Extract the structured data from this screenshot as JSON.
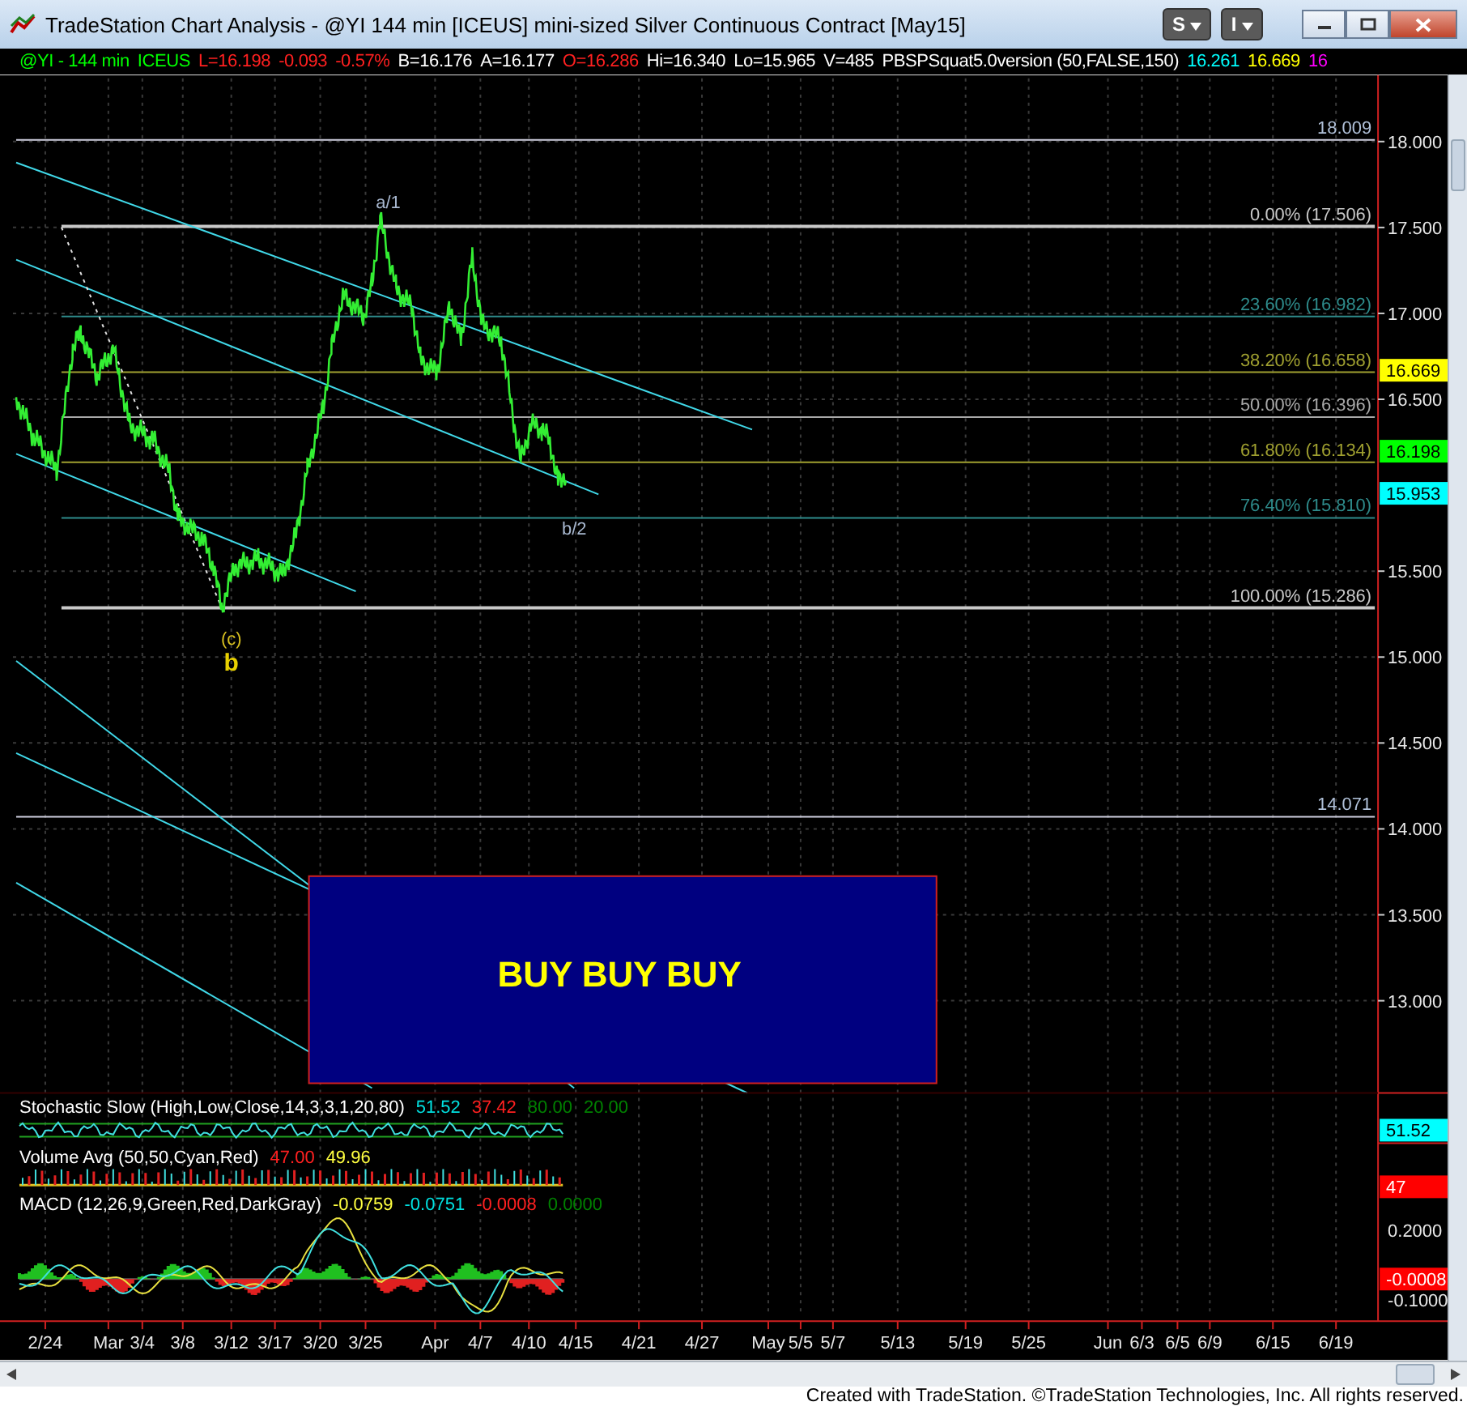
{
  "window": {
    "title": "TradeStation Chart Analysis - @YI 144 min [ICEUS] mini-sized Silver Continuous Contract [May15]"
  },
  "toolbar_buttons": [
    {
      "label": "S"
    },
    {
      "label": "I"
    }
  ],
  "status_line": [
    {
      "text": "@YI - 144 min",
      "color": "#00ff00"
    },
    {
      "text": "ICEUS",
      "color": "#00ff00"
    },
    {
      "text": "L=16.198",
      "color": "#ff2020"
    },
    {
      "text": "-0.093",
      "color": "#ff2020"
    },
    {
      "text": "-0.57%",
      "color": "#ff2020"
    },
    {
      "text": "B=16.176",
      "color": "#ffffff"
    },
    {
      "text": "A=16.177",
      "color": "#ffffff"
    },
    {
      "text": "O=16.286",
      "color": "#ff2020"
    },
    {
      "text": "Hi=16.340",
      "color": "#ffffff"
    },
    {
      "text": "Lo=15.965",
      "color": "#ffffff"
    },
    {
      "text": "V=485",
      "color": "#ffffff"
    },
    {
      "text": "PBSPSquat5.0version (50,FALSE,150)",
      "color": "#ffffff"
    },
    {
      "text": "16.261",
      "color": "#00ffff"
    },
    {
      "text": "16.669",
      "color": "#ffff00"
    },
    {
      "text": "16",
      "color": "#ff00ff"
    }
  ],
  "price_axis": {
    "labels": [
      "18.000",
      "17.500",
      "17.000",
      "16.500",
      "15.500",
      "15.000",
      "14.500",
      "14.000",
      "13.500",
      "13.000"
    ],
    "markers": [
      {
        "text": "16.669",
        "color": "#ffff00"
      },
      {
        "text": "16.198",
        "color": "#00ff00"
      },
      {
        "text": "15.953",
        "color": "#00ffff"
      }
    ]
  },
  "levels": [
    {
      "label": "18.009"
    },
    {
      "label": "14.071"
    }
  ],
  "fib_lines": [
    {
      "label": "0.00% (17.506)",
      "color": "#c8c8c8"
    },
    {
      "label": "23.60% (16.982)",
      "color": "#2e8b8b"
    },
    {
      "label": "38.20% (16.658)",
      "color": "#a0a030"
    },
    {
      "label": "50.00% (16.396)",
      "color": "#a8a8a8"
    },
    {
      "label": "61.80% (16.134)",
      "color": "#a0a030"
    },
    {
      "label": "76.40% (15.810)",
      "color": "#2e8b8b"
    },
    {
      "label": "100.00% (15.286)",
      "color": "#c8c8c8"
    }
  ],
  "annotations": [
    {
      "text": "a/1"
    },
    {
      "text": "b/2"
    },
    {
      "text": "(c)"
    },
    {
      "text": "b"
    }
  ],
  "buy_box": {
    "text": "BUY BUY BUY"
  },
  "indicators": [
    {
      "label": "Stochastic Slow (High,Low,Close,14,3,3,1,20,80)",
      "values": [
        {
          "text": "51.52",
          "color": "#00e0e0"
        },
        {
          "text": "37.42",
          "color": "#ff2020"
        },
        {
          "text": "80.00",
          "color": "#008000"
        },
        {
          "text": "20.00",
          "color": "#008000"
        }
      ],
      "axis_marker": {
        "text": "51.52",
        "color": "#00ffff"
      }
    },
    {
      "label": "Volume Avg (50,50,Cyan,Red)",
      "values": [
        {
          "text": "47.00",
          "color": "#ff2020"
        },
        {
          "text": "49.96",
          "color": "#ffff40"
        }
      ],
      "axis_marker": {
        "text": "47",
        "color": "#ff0000"
      }
    },
    {
      "label": "MACD (12,26,9,Green,Red,DarkGray)",
      "values": [
        {
          "text": "-0.0759",
          "color": "#ffff40"
        },
        {
          "text": "-0.0751",
          "color": "#00e0e0"
        },
        {
          "text": "-0.0008",
          "color": "#ff2020"
        },
        {
          "text": "0.0000",
          "color": "#008000"
        }
      ],
      "axis_marker": {
        "text": "-0.0008",
        "color": "#ff0000"
      }
    }
  ],
  "macd_axis": [
    "0.2000",
    "-0.1000"
  ],
  "date_axis": [
    "2/24",
    "Mar",
    "3/4",
    "3/8",
    "3/12",
    "3/17",
    "3/20",
    "3/25",
    "Apr",
    "4/7",
    "4/10",
    "4/15",
    "4/21",
    "4/27",
    "May",
    "5/5",
    "5/7",
    "5/13",
    "5/19",
    "5/25",
    "Jun",
    "6/3",
    "6/5",
    "6/9",
    "6/15",
    "6/19"
  ],
  "footer": "Created with TradeStation. ©TradeStation Technologies, Inc. All rights reserved."
}
